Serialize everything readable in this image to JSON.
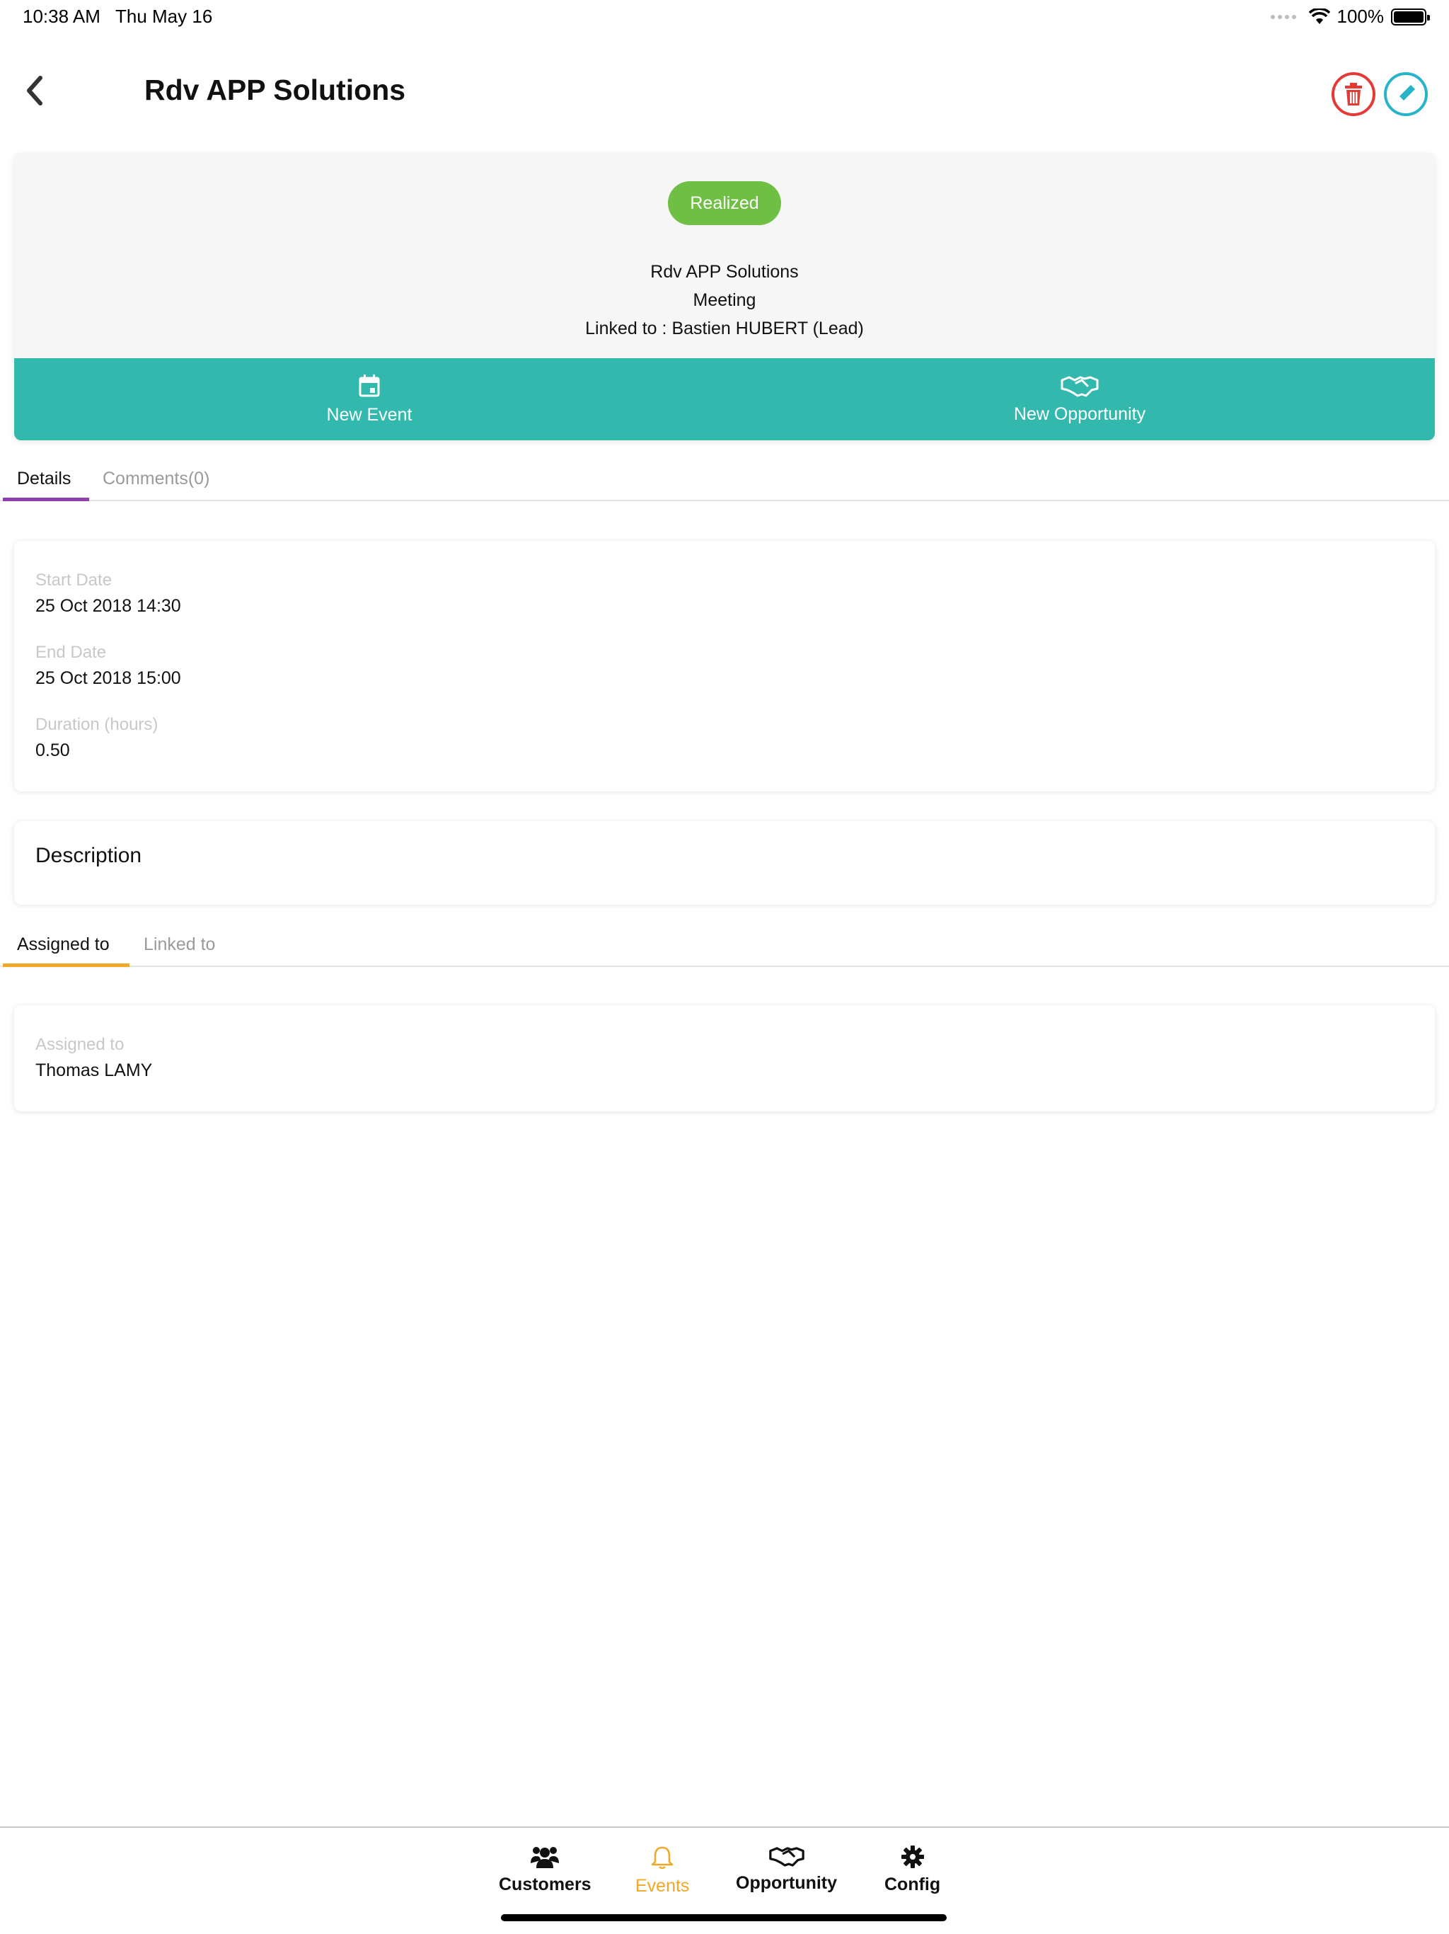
{
  "status_bar": {
    "time": "10:38 AM",
    "date": "Thu May 16",
    "battery": "100%"
  },
  "header": {
    "title": "Rdv APP Solutions"
  },
  "summary": {
    "status": "Realized",
    "status_color": "#6fbf44",
    "name": "Rdv APP Solutions",
    "type": "Meeting",
    "linked_label": "Linked to :",
    "linked_value": "Bastien HUBERT (Lead)"
  },
  "actions": {
    "new_event": "New Event",
    "new_opportunity": "New Opportunity",
    "color": "#33b8ad"
  },
  "tabs_top": {
    "details": "Details",
    "comments": "Comments(0)",
    "accent": "#8e3fb0"
  },
  "details": {
    "start_label": "Start Date",
    "start_value": "25 Oct 2018 14:30",
    "end_label": "End Date",
    "end_value": "25 Oct 2018 15:00",
    "duration_label": "Duration (hours)",
    "duration_value": "0.50"
  },
  "description": {
    "title": "Description"
  },
  "tabs_bottom": {
    "assigned": "Assigned to",
    "linked": "Linked to",
    "accent": "#f0a826"
  },
  "assigned": {
    "label": "Assigned to",
    "value": "Thomas LAMY"
  },
  "bottom_nav": {
    "customers": "Customers",
    "events": "Events",
    "opportunity": "Opportunity",
    "config": "Config",
    "active_color": "#f0a826"
  }
}
